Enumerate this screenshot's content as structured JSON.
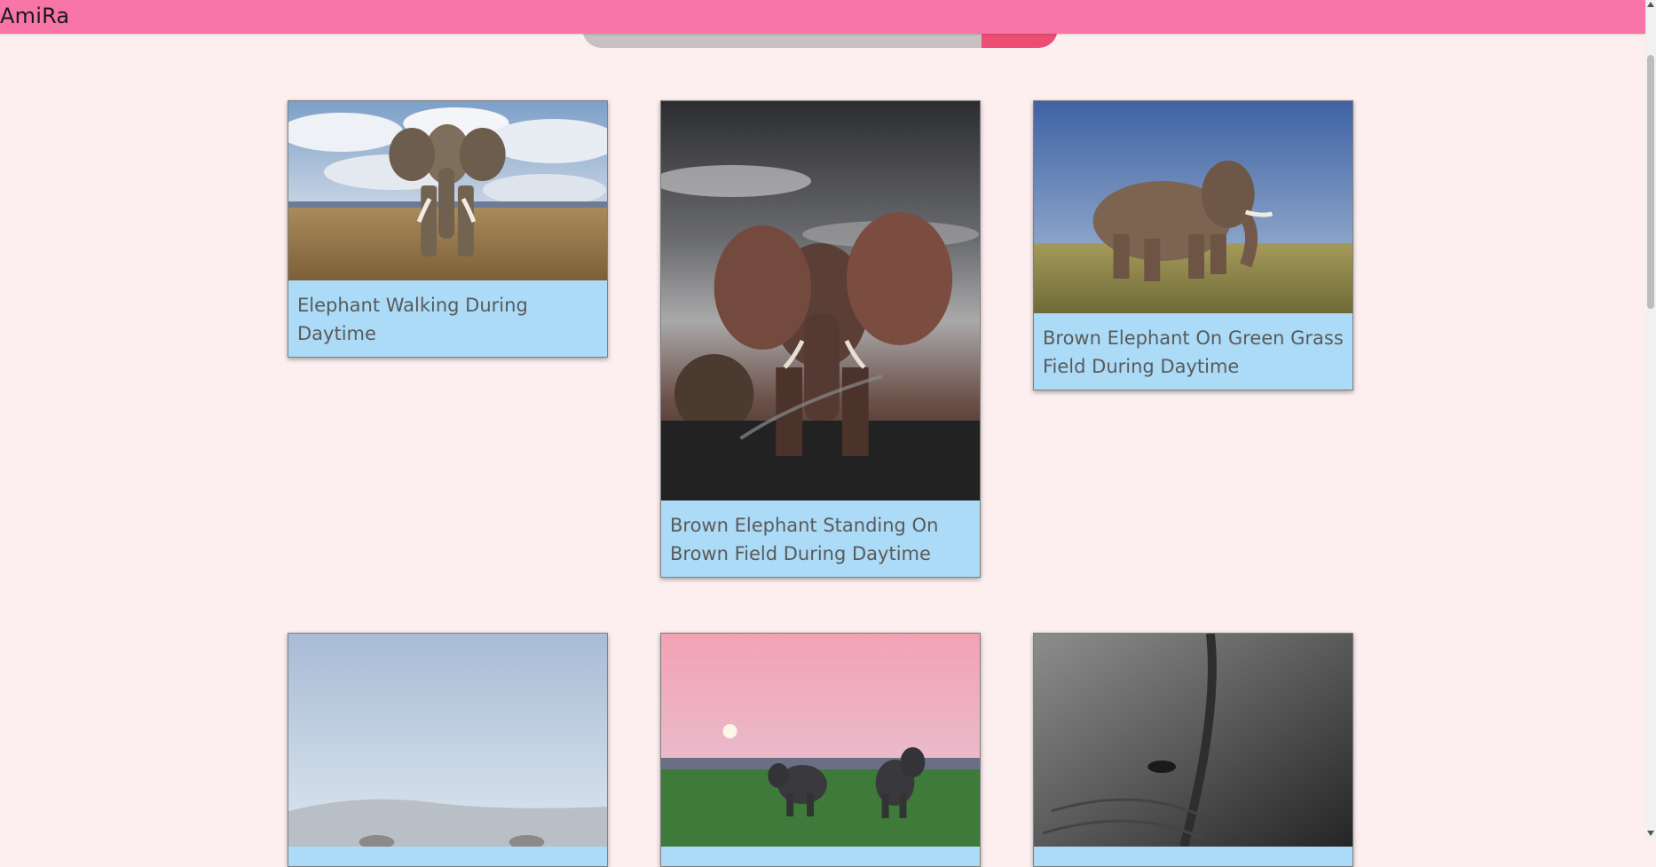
{
  "brand": "AmiRa",
  "search": {
    "placeholder": ""
  },
  "cards": [
    {
      "caption": "Elephant Walking During Daytime",
      "image": "elephant-cloudy-savanna"
    },
    {
      "caption": "Brown Elephant Standing On Brown Field During Daytime",
      "image": "elephant-dark-sky-splash"
    },
    {
      "caption": "Brown Elephant On Green Grass Field During Daytime",
      "image": "elephant-walking-grass"
    },
    {
      "caption": "",
      "image": "elephants-misty-hills"
    },
    {
      "caption": "",
      "image": "elephants-pink-sunset"
    },
    {
      "caption": "",
      "image": "elephant-closeup-grayscale"
    }
  ],
  "colors": {
    "navbar": "#f775a7",
    "background": "#fdeff0",
    "card": "#abdbf7",
    "search_button": "#ec4d72"
  }
}
